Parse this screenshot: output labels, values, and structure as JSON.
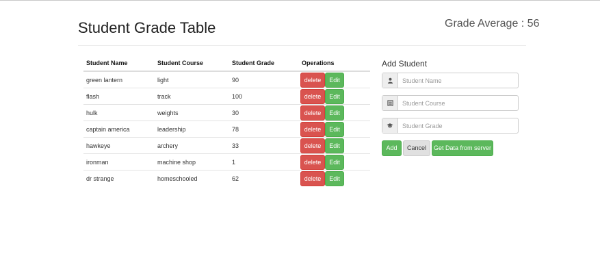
{
  "header": {
    "title": "Student Grade Table",
    "grade_average_label": "Grade Average : 56"
  },
  "table": {
    "columns": [
      "Student Name",
      "Student Course",
      "Student Grade",
      "Operations"
    ],
    "rows": [
      {
        "name": "green lantern",
        "course": "light",
        "grade": "90"
      },
      {
        "name": "flash",
        "course": "track",
        "grade": "100"
      },
      {
        "name": "hulk",
        "course": "weights",
        "grade": "30"
      },
      {
        "name": "captain america",
        "course": "leadership",
        "grade": "78"
      },
      {
        "name": "hawkeye",
        "course": "archery",
        "grade": "33"
      },
      {
        "name": "ironman",
        "course": "machine shop",
        "grade": "1"
      },
      {
        "name": "dr strange",
        "course": "homeschooled",
        "grade": "62"
      }
    ],
    "delete_label": "delete",
    "edit_label": "Edit"
  },
  "form": {
    "title": "Add Student",
    "name_placeholder": "Student Name",
    "name_value": "",
    "course_placeholder": "Student Course",
    "course_value": "",
    "grade_placeholder": "Student Grade",
    "grade_value": "",
    "add_label": "Add",
    "cancel_label": "Cancel",
    "server_label": "Get Data from server"
  },
  "colors": {
    "danger": "#d9534f",
    "success": "#5cb85c",
    "default": "#e0e0e0"
  },
  "icons": {
    "name": "user-icon",
    "course": "list-alt-icon",
    "grade": "education-icon"
  }
}
